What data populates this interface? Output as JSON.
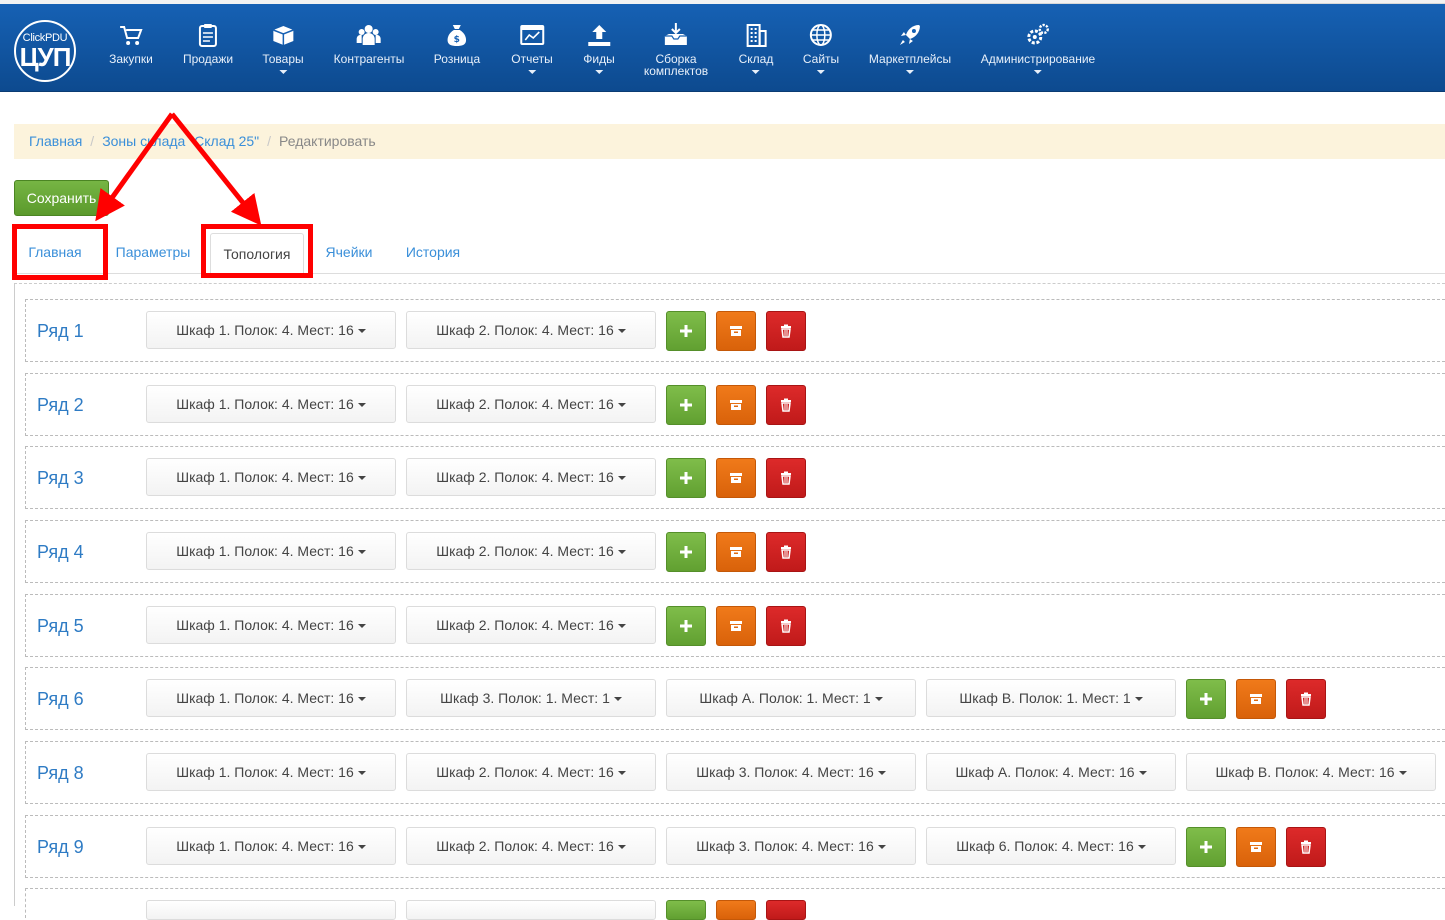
{
  "logo": {
    "line1": "ClickPDU",
    "line2": "ЦУП"
  },
  "nav": [
    {
      "label": "Закупки",
      "icon": "cart-icon",
      "caret": false
    },
    {
      "label": "Продажи",
      "icon": "clipboard-icon",
      "caret": false
    },
    {
      "label": "Товары",
      "icon": "box-icon",
      "caret": true
    },
    {
      "label": "Контрагенты",
      "icon": "users-icon",
      "caret": false
    },
    {
      "label": "Розница",
      "icon": "money-bag-icon",
      "caret": false
    },
    {
      "label": "Отчеты",
      "icon": "report-chart-icon",
      "caret": true
    },
    {
      "label": "Фиды",
      "icon": "upload-icon",
      "caret": true
    },
    {
      "label": "Сборка комплектов",
      "label_line1": "Сборка",
      "label_line2": "комплектов",
      "icon": "inbox-download-icon",
      "caret": false
    },
    {
      "label": "Склад",
      "icon": "building-icon",
      "caret": true
    },
    {
      "label": "Сайты",
      "icon": "globe-icon",
      "caret": true
    },
    {
      "label": "Маркетплейсы",
      "icon": "rocket-icon",
      "caret": true
    },
    {
      "label": "Администрирование",
      "icon": "gears-icon",
      "caret": true
    }
  ],
  "breadcrumb": {
    "home": "Главная",
    "zone": "Зоны склада \"Склад 25\"",
    "current": "Редактировать"
  },
  "save_label": "Сохранить",
  "tabs": [
    {
      "label": "Главная",
      "active": false
    },
    {
      "label": "Параметры",
      "active": false
    },
    {
      "label": "Топология",
      "active": true
    },
    {
      "label": "Ячейки",
      "active": false
    },
    {
      "label": "История",
      "active": false
    }
  ],
  "rows": [
    {
      "title": "Ряд 1",
      "cabinets": [
        "Шкаф 1. Полок: 4. Мест: 16",
        "Шкаф 2. Полок: 4. Мест: 16"
      ]
    },
    {
      "title": "Ряд 2",
      "cabinets": [
        "Шкаф 1. Полок: 4. Мест: 16",
        "Шкаф 2. Полок: 4. Мест: 16"
      ]
    },
    {
      "title": "Ряд 3",
      "cabinets": [
        "Шкаф 1. Полок: 4. Мест: 16",
        "Шкаф 2. Полок: 4. Мест: 16"
      ]
    },
    {
      "title": "Ряд 4",
      "cabinets": [
        "Шкаф 1. Полок: 4. Мест: 16",
        "Шкаф 2. Полок: 4. Мест: 16"
      ]
    },
    {
      "title": "Ряд 5",
      "cabinets": [
        "Шкаф 1. Полок: 4. Мест: 16",
        "Шкаф 2. Полок: 4. Мест: 16"
      ]
    },
    {
      "title": "Ряд 6",
      "cabinets": [
        "Шкаф 1. Полок: 4. Мест: 16",
        "Шкаф 3. Полок: 1. Мест: 1",
        "Шкаф А. Полок: 1. Мест: 1",
        "Шкаф В. Полок: 1. Мест: 1"
      ]
    },
    {
      "title": "Ряд 8",
      "cabinets": [
        "Шкаф 1. Полок: 4. Мест: 16",
        "Шкаф 2. Полок: 4. Мест: 16",
        "Шкаф 3. Полок: 4. Мест: 16",
        "Шкаф А. Полок: 4. Мест: 16",
        "Шкаф В. Полок: 4. Мест: 16"
      ]
    },
    {
      "title": "Ряд 9",
      "cabinets": [
        "Шкаф 1. Полок: 4. Мест: 16",
        "Шкаф 2. Полок: 4. Мест: 16",
        "Шкаф 3. Полок: 4. Мест: 16",
        "Шкаф 6. Полок: 4. Мест: 16"
      ]
    }
  ],
  "row_actions": {
    "add": "plus-icon",
    "archive": "archive-icon",
    "delete": "trash-icon"
  },
  "colors": {
    "navbar": "#1661b4",
    "link": "#3a8fd9",
    "success": "#6aaa38",
    "warning": "#e86f12",
    "danger": "#cc2020",
    "annotation": "#ff0000"
  }
}
